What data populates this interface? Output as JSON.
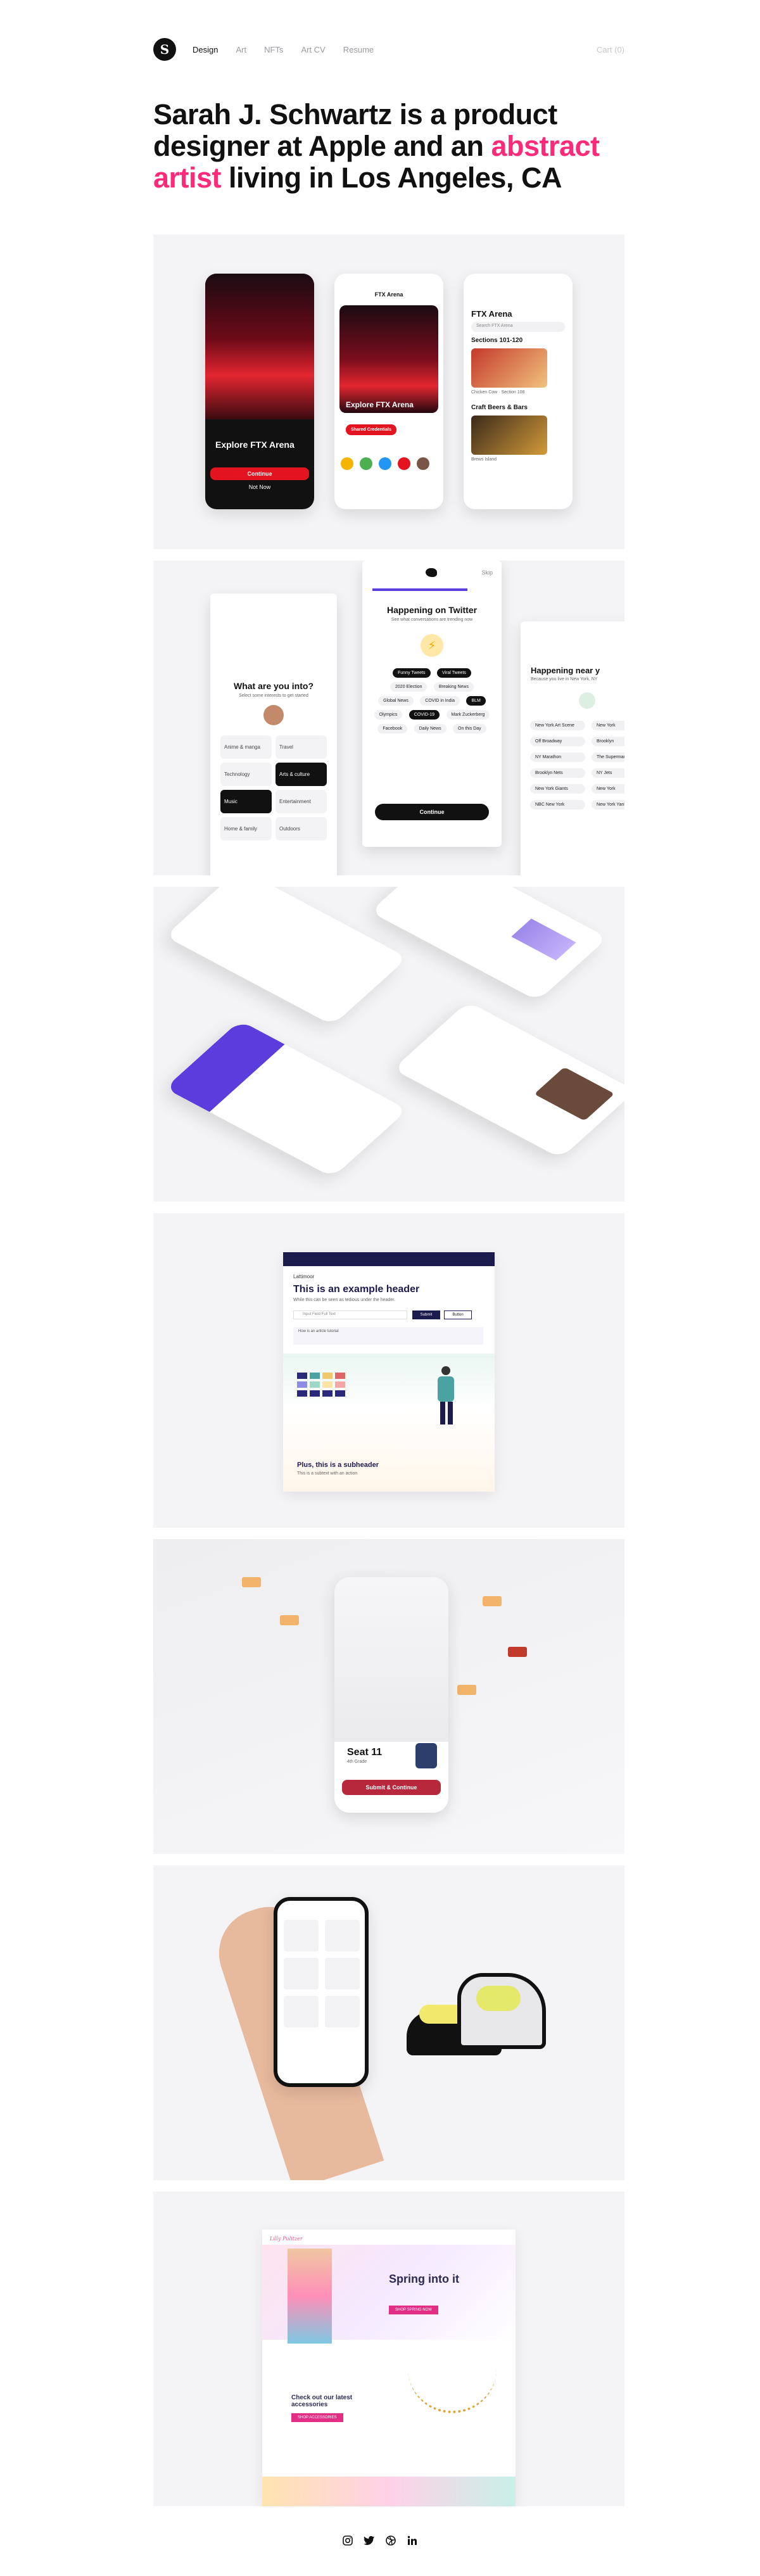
{
  "nav": {
    "logo_letter": "S",
    "links": [
      "Design",
      "Art",
      "NFTs",
      "Art CV",
      "Resume"
    ],
    "cart": "Cart (0)"
  },
  "hero": {
    "part1": "Sarah J. Schwartz is a product designer at Apple and an ",
    "highlight": "abstract artist",
    "part2": " living in Los Angeles, CA"
  },
  "p1": {
    "phone1_title": "Explore FTX Arena",
    "phone1_btn": "Continue",
    "phone1_link": "Not Now",
    "phone2_header": "FTX Arena",
    "phone2_title": "Explore FTX Arena",
    "phone2_btn": "Shared Credentials",
    "phone3_title": "FTX Arena",
    "phone3_sub": "Sections 101-120",
    "phone3_search": "Search FTX Arena",
    "phone3_item1": "Chicken Cow · Section 108",
    "phone3_section2": "Craft Beers & Bars",
    "phone3_item2": "Brews Island"
  },
  "p2": {
    "left_title": "What are you into?",
    "left_sub": "Select some interests to get started",
    "left_items": [
      "Anime & manga",
      "Travel",
      "Technology",
      "Arts & culture",
      "Music",
      "Entertainment",
      "Home & family",
      "Outdoors"
    ],
    "center_title": "Happening on Twitter",
    "center_sub": "See what conversations are trending now",
    "center_pills": [
      "Funny Tweets",
      "Viral Tweets",
      "2020 Election",
      "Breaking News",
      "Global News",
      "COVID in India",
      "BLM",
      "Olympics",
      "COVID-19",
      "Mark Zuckerberg",
      "Facebook",
      "Daily News",
      "On this Day"
    ],
    "center_btn": "Continue",
    "center_skip": "Skip",
    "right_title": "Happening near y",
    "right_sub": "Because you live in New York, NY",
    "right_items": [
      "New York Art Scene",
      "New York",
      "Off Broadway",
      "Brooklyn",
      "NY Marathon",
      "The Supermarket",
      "Brooklyn Nets",
      "NY Jets",
      "New York Giants",
      "New York",
      "NBC New York",
      "New York Yankees"
    ]
  },
  "p4": {
    "brand": "Lattimoor",
    "title": "This is an example header",
    "sub": "While this can be seen as tedious under the header.",
    "input_placeholder": "Input Field Full Text",
    "btn1": "Submit",
    "btn2": "Button",
    "note_title": "How is an article tutorial",
    "subheader": "Plus, this is a subheader",
    "subheader_sub": "This is a subtext with an action"
  },
  "p5": {
    "seat_title": "Seat 11",
    "seat_sub": "4th Grade",
    "btn": "Submit & Continue"
  },
  "p7": {
    "brand": "Lilly Pulitzer",
    "hero_title": "Spring into it",
    "hero_btn": "SHOP SPRING NOW",
    "section_title": "Check out our latest accessories",
    "section_btn": "SHOP ACCESSORIES"
  },
  "footer": {
    "icons": [
      "instagram-icon",
      "twitter-icon",
      "dribbble-icon",
      "linkedin-icon"
    ]
  },
  "colors": {
    "accent_pink": "#ff2b7a",
    "panel_bg": "#f4f4f6",
    "ftx_red": "#e3141f",
    "twitter_purple": "#5b3cdc"
  }
}
